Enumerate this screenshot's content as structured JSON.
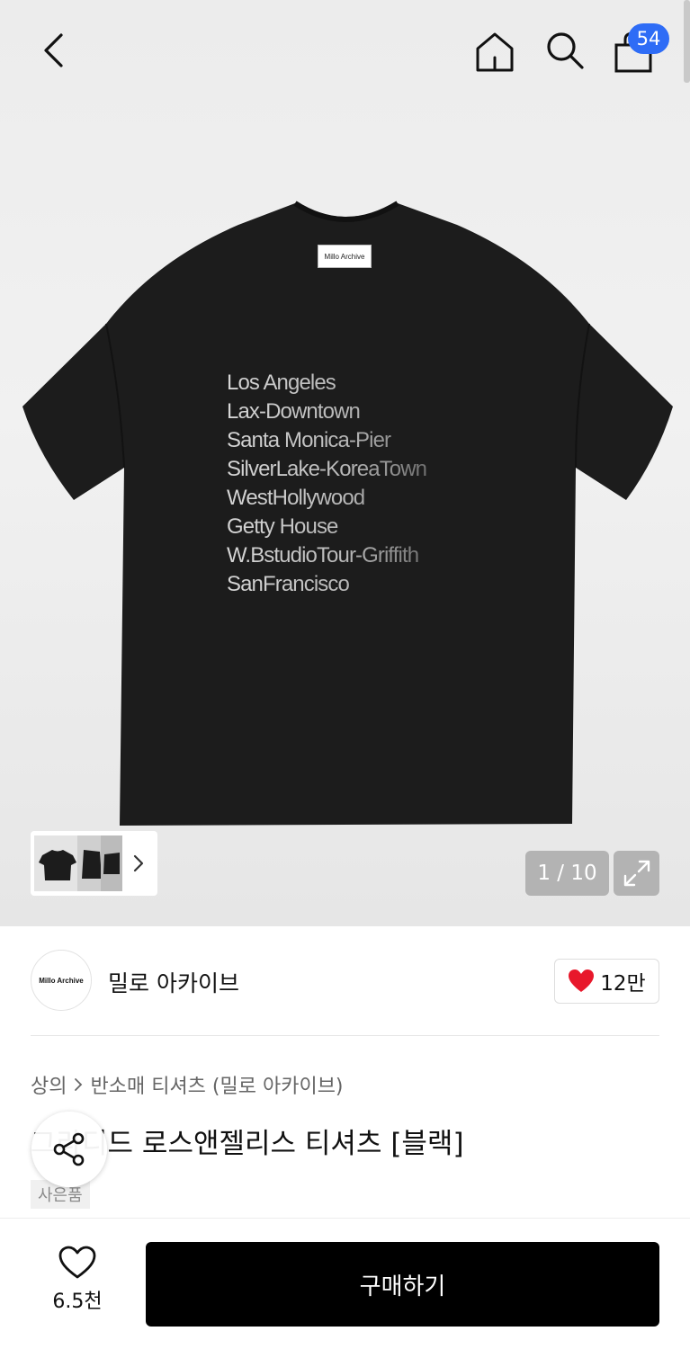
{
  "header": {
    "cart_badge": "54"
  },
  "product_image": {
    "tag_text": "Millo Archive",
    "print_lines": [
      "Los Angeles",
      "Lax-Downtown",
      "Santa Monica-Pier",
      "SilverLake-KoreaTown",
      "WestHollywood",
      "Getty House",
      "W.BstudioTour-Griffith",
      "SanFrancisco"
    ],
    "page_counter": "1 / 10"
  },
  "brand": {
    "logo_text": "Millo Archive",
    "name": "밀로 아카이브",
    "likes": "12만"
  },
  "breadcrumb": {
    "category": "상의",
    "subcategory": "반소매 티셔츠 (밀로 아카이브)"
  },
  "product": {
    "title": "그라디드 로스앤젤리스 티셔츠 [블랙]",
    "gift_badge": "사은품"
  },
  "bottom_bar": {
    "wish_count": "6.5천",
    "buy_label": "구매하기"
  },
  "colors": {
    "badge": "#2e6cf6",
    "heart": "#e8182b",
    "buy_button": "#000000"
  }
}
